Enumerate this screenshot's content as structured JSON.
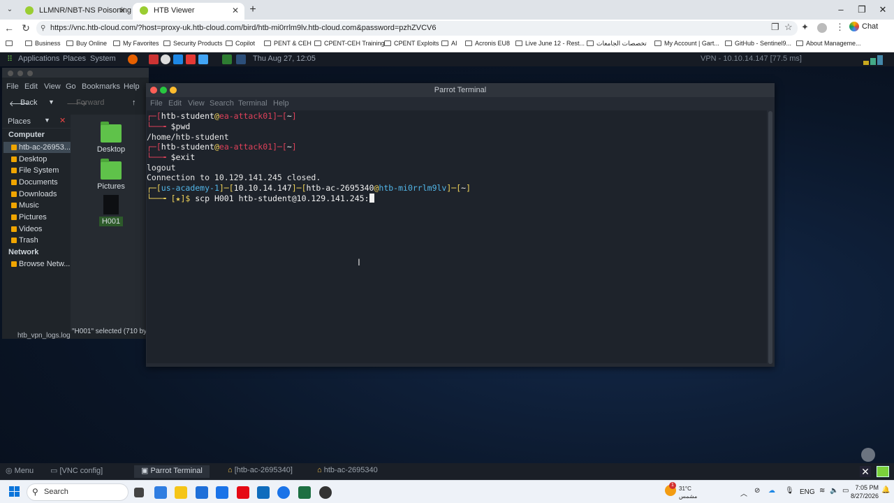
{
  "browser": {
    "tabs": [
      {
        "title": "LLMNR/NBT-NS Poisoning - from",
        "active": false
      },
      {
        "title": "HTB Viewer",
        "active": true
      }
    ],
    "url": "https://vnc.htb-cloud.com/?host=proxy-uk.htb-cloud.com/bird/htb-mi0rrlm9lv.htb-cloud.com&password=pzhZVCV6",
    "chat_label": "Chat",
    "bookmarks": [
      "Business",
      "Buy Online",
      "My Favorites",
      "Security Products",
      "Copilot",
      "PENT & CEH",
      "CPENT-CEH Training",
      "CPENT Exploits",
      "AI",
      "Acronis EU8",
      "Live June 12 - Rest...",
      "تخصصات الجامعات",
      "My Account | Gart...",
      "GitHub - Sentinel9...",
      "About Manageme..."
    ]
  },
  "vnc": {
    "topbar": {
      "applications": "Applications",
      "places": "Places",
      "system": "System",
      "datetime": "Thu Aug 27, 12:05",
      "vpn": "VPN - 10.10.14.147 [77.5 ms]"
    },
    "file_manager": {
      "window_title": "htb-ac-2695340",
      "menu": [
        "File",
        "Edit",
        "View",
        "Go",
        "Bookmarks",
        "Help"
      ],
      "back": "Back",
      "forward": "Forward",
      "path_crumb": "htb-ac-2",
      "places_header": "Places",
      "sections": {
        "computer": "Computer",
        "network": "Network"
      },
      "sidebar_items": [
        "htb-ac-26953...",
        "Desktop",
        "File System",
        "Documents",
        "Downloads",
        "Music",
        "Pictures",
        "Videos",
        "Trash"
      ],
      "network_items": [
        "Browse Netw..."
      ],
      "icons": [
        "Desktop",
        "Pictures",
        "H001"
      ],
      "status": "\"H001\" selected (710 by"
    },
    "desktop_file": "htb_vpn_logs.log",
    "terminal": {
      "title": "Parrot Terminal",
      "menu": [
        "File",
        "Edit",
        "View",
        "Search",
        "Terminal",
        "Help"
      ],
      "lines": {
        "l1_user": "htb-student",
        "l1_host": "ea-attack01",
        "l1_dir": "~",
        "cmd_pwd": "$pwd",
        "out_pwd": "/home/htb-student",
        "cmd_exit": "$exit",
        "out_logout": "logout",
        "out_closed": "Connection to 10.129.141.245 closed.",
        "p2_academy": "us-academy-1",
        "p2_ip": "10.10.14.147",
        "p2_user": "htb-ac-2695340",
        "p2_host": "htb-mi0rrlm9lv",
        "p2_dir": "~",
        "p2_star": "[★]$",
        "p2_cmd": " scp H001 htb-student@10.129.141.245:"
      }
    },
    "taskbar": [
      "Menu",
      "[VNC config]",
      "Parrot Terminal",
      "[htb-ac-2695340]",
      "htb-ac-2695340"
    ]
  },
  "windows": {
    "search_placeholder": "Search",
    "weather": "31°C",
    "weather_desc": "مشمس",
    "lang": "ENG",
    "time": "7:05 PM",
    "date": "8/27/2026",
    "badge": "1"
  },
  "colors": {
    "prompt_red": "#e0415a",
    "prompt_yellow": "#f2d55a",
    "prompt_cyan": "#52b6e8",
    "terminal_bg": "#1e232b"
  }
}
